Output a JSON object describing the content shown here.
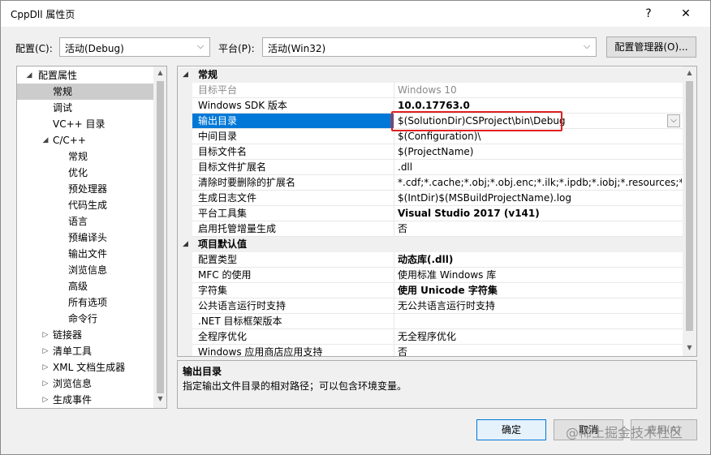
{
  "window": {
    "title": "CppDll 属性页",
    "help_glyph": "?",
    "close_glyph": "✕"
  },
  "toolbar": {
    "config_label": "配置(C):",
    "config_value": "活动(Debug)",
    "platform_label": "平台(P):",
    "platform_value": "活动(Win32)",
    "config_manager_label": "配置管理器(O)..."
  },
  "tree": {
    "items": [
      {
        "label": "配置属性",
        "caret": "◢"
      },
      {
        "label": "常规",
        "caret": ""
      },
      {
        "label": "调试",
        "caret": ""
      },
      {
        "label": "VC++ 目录",
        "caret": ""
      },
      {
        "label": "C/C++",
        "caret": "◢"
      },
      {
        "label": "常规",
        "caret": ""
      },
      {
        "label": "优化",
        "caret": ""
      },
      {
        "label": "预处理器",
        "caret": ""
      },
      {
        "label": "代码生成",
        "caret": ""
      },
      {
        "label": "语言",
        "caret": ""
      },
      {
        "label": "预编译头",
        "caret": ""
      },
      {
        "label": "输出文件",
        "caret": ""
      },
      {
        "label": "浏览信息",
        "caret": ""
      },
      {
        "label": "高级",
        "caret": ""
      },
      {
        "label": "所有选项",
        "caret": ""
      },
      {
        "label": "命令行",
        "caret": ""
      },
      {
        "label": "链接器",
        "caret": "▷"
      },
      {
        "label": "清单工具",
        "caret": "▷"
      },
      {
        "label": "XML 文档生成器",
        "caret": "▷"
      },
      {
        "label": "浏览信息",
        "caret": "▷"
      },
      {
        "label": "生成事件",
        "caret": "▷"
      }
    ]
  },
  "grid": {
    "categories": [
      {
        "label": "常规",
        "expander": "◢"
      },
      {
        "label": "项目默认值",
        "expander": "◢"
      }
    ],
    "rows": [
      {
        "name": "目标平台",
        "value": "Windows 10"
      },
      {
        "name": "Windows SDK 版本",
        "value": "10.0.17763.0"
      },
      {
        "name": "输出目录",
        "value": "$(SolutionDir)CSProject\\bin\\Debug"
      },
      {
        "name": "中间目录",
        "value": "$(Configuration)\\"
      },
      {
        "name": "目标文件名",
        "value": "$(ProjectName)"
      },
      {
        "name": "目标文件扩展名",
        "value": ".dll"
      },
      {
        "name": "清除时要删除的扩展名",
        "value": "*.cdf;*.cache;*.obj;*.obj.enc;*.ilk;*.ipdb;*.iobj;*.resources;*.tlb;*"
      },
      {
        "name": "生成日志文件",
        "value": "$(IntDir)$(MSBuildProjectName).log"
      },
      {
        "name": "平台工具集",
        "value": "Visual Studio 2017 (v141)"
      },
      {
        "name": "启用托管增量生成",
        "value": "否"
      },
      {
        "name": "配置类型",
        "value": "动态库(.dll)"
      },
      {
        "name": "MFC 的使用",
        "value": "使用标准 Windows 库"
      },
      {
        "name": "字符集",
        "value": "使用 Unicode 字符集"
      },
      {
        "name": "公共语言运行时支持",
        "value": "无公共语言运行时支持"
      },
      {
        "name": ".NET 目标框架版本",
        "value": ""
      },
      {
        "name": "全程序优化",
        "value": "无全程序优化"
      },
      {
        "name": "Windows 应用商店应用支持",
        "value": "否"
      }
    ]
  },
  "description": {
    "title": "输出目录",
    "text": "指定输出文件目录的相对路径；可以包含环境变量。"
  },
  "footer": {
    "ok_label": "确定",
    "cancel_label": "取消",
    "apply_label": "应用(A)",
    "watermark": "@稀土掘金技术社区"
  },
  "colors": {
    "selection": "#0078d7",
    "highlight_box": "#e02020",
    "tree_selection": "#cccccc"
  }
}
